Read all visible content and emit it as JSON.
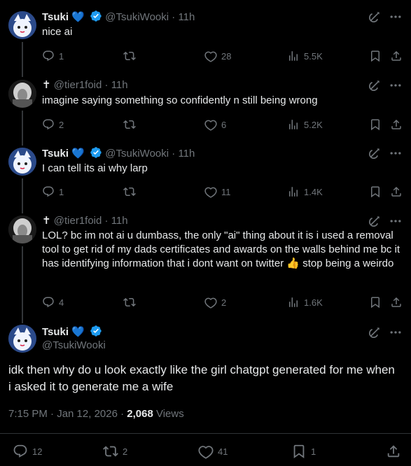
{
  "replies": [
    {
      "name": "Tsuki",
      "emoji": "💙",
      "handle": "@TsukiWooki",
      "time": "11h",
      "text": "nice ai",
      "replies": "1",
      "retweets": "",
      "likes": "28",
      "views": "5.5K"
    },
    {
      "name": "✝",
      "emoji": "",
      "handle": "@tier1foid",
      "time": "11h",
      "text": "imagine saying something so confidently n still being wrong",
      "replies": "2",
      "retweets": "",
      "likes": "6",
      "views": "5.2K"
    },
    {
      "name": "Tsuki",
      "emoji": "💙",
      "handle": "@TsukiWooki",
      "time": "11h",
      "text": "I can tell its ai why larp",
      "replies": "1",
      "retweets": "",
      "likes": "11",
      "views": "1.4K"
    },
    {
      "name": "✝",
      "emoji": "",
      "handle": "@tier1foid",
      "time": "11h",
      "text": "LOL? bc im not ai u dumbass, the only \"ai\" thing about it is i used a removal tool to get rid of my dads certificates and awards on the walls behind me bc it has identifying information that i dont want on twitter 👍 stop being a weirdo",
      "replies": "4",
      "retweets": "",
      "likes": "2",
      "views": "1.6K"
    }
  ],
  "main": {
    "name": "Tsuki",
    "emoji": "💙",
    "handle": "@TsukiWooki",
    "text": "idk then why do u look exactly like the girl chatgpt generated for me when i asked it to generate me a wife",
    "time": "7:15 PM · Jan 12, 2026 · ",
    "views_count": "2,068",
    "views_label": " Views",
    "replies": "12",
    "retweets": "2",
    "likes": "41",
    "bookmarks": "1"
  },
  "colors": {
    "background": "#000000",
    "text": "#e7e9ea",
    "muted": "#71767b",
    "verified": "#1d9bf0"
  }
}
